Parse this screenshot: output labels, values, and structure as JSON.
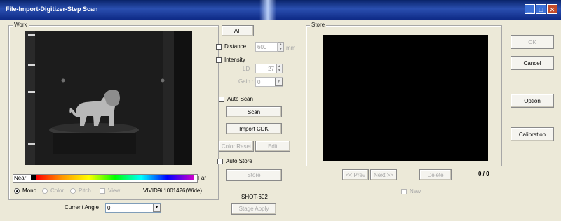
{
  "window": {
    "title": "File-Import-Digitizer-Step Scan"
  },
  "work": {
    "label": "Work",
    "colorbar": {
      "near": "Near",
      "far": "Far"
    },
    "modes": [
      {
        "label": "Mono",
        "selected": true,
        "enabled": true
      },
      {
        "label": "Color",
        "selected": false,
        "enabled": false
      },
      {
        "label": "Pitch",
        "selected": false,
        "enabled": false
      }
    ],
    "view_label": "View",
    "device_info": "VIVID9i 1001426(Wide)",
    "angle_label": "Current Angle",
    "angle_value": "0"
  },
  "controls": {
    "af_label": "AF",
    "distance_label": "Distance",
    "distance_value": "600",
    "distance_unit": "mm",
    "intensity_label": "Intensity",
    "ld_label": "LD :",
    "ld_value": "27",
    "gain_label": "Gain :",
    "gain_value": "0",
    "auto_scan_label": "Auto Scan",
    "scan_label": "Scan",
    "import_cdk_label": "Import CDK",
    "color_reset_label": "Color Reset",
    "edit_label": "Edit",
    "auto_store_label": "Auto Store",
    "store_label": "Store",
    "stage_model": "SHOT-602",
    "stage_apply_label": "Stage Apply"
  },
  "store": {
    "label": "Store",
    "prev_label": "<< Prev",
    "next_label": "Next >>",
    "delete_label": "Delete",
    "counter": "0 / 0",
    "new_label": "New"
  },
  "side_buttons": {
    "ok": "OK",
    "cancel": "Cancel",
    "option": "Option",
    "calibration": "Calibration"
  },
  "colors": {
    "title_bar": "#0a246a",
    "window_bg": "#ece9d8"
  }
}
